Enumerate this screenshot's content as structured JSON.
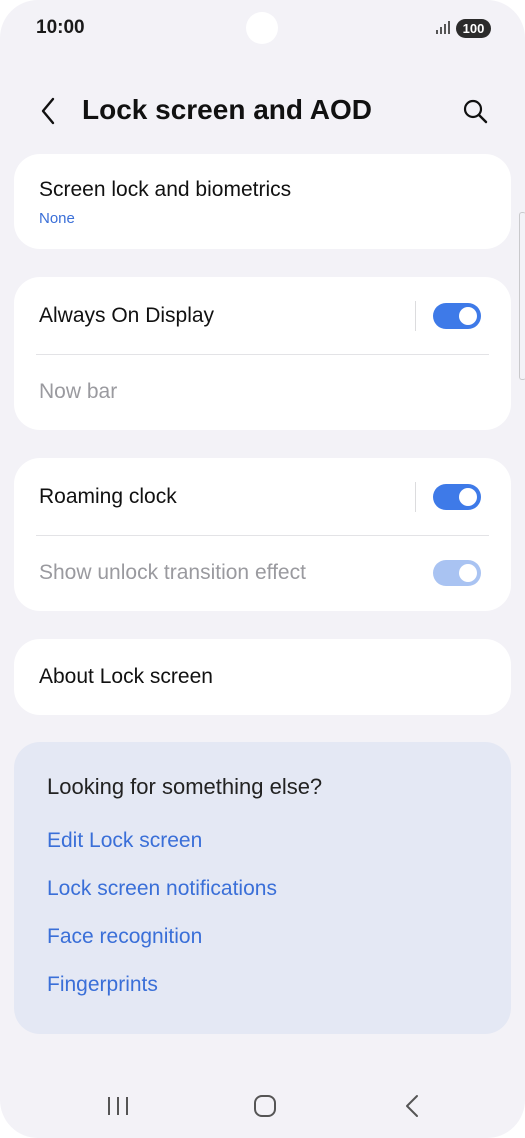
{
  "status_bar": {
    "time": "10:00",
    "battery": "100"
  },
  "header": {
    "title": "Lock screen and AOD"
  },
  "settings": {
    "screen_lock": {
      "title": "Screen lock and biometrics",
      "subtitle": "None"
    },
    "always_on_display": {
      "title": "Always On Display",
      "enabled": true
    },
    "now_bar": {
      "title": "Now bar"
    },
    "roaming_clock": {
      "title": "Roaming clock",
      "enabled": true
    },
    "unlock_transition": {
      "title": "Show unlock transition effect",
      "enabled": true
    },
    "about": {
      "title": "About Lock screen"
    }
  },
  "suggestions": {
    "title": "Looking for something else?",
    "links": [
      "Edit Lock screen",
      "Lock screen notifications",
      "Face recognition",
      "Fingerprints"
    ]
  },
  "colors": {
    "accent": "#3e7ae8",
    "link": "#3a6fd8",
    "background": "#f3f2f7",
    "suggestion_card": "#e4e8f4"
  },
  "icons": {
    "back": "chevron-left-icon",
    "search": "search-icon",
    "nav_recents": "recents-icon",
    "nav_home": "home-icon",
    "nav_back": "back-icon"
  }
}
